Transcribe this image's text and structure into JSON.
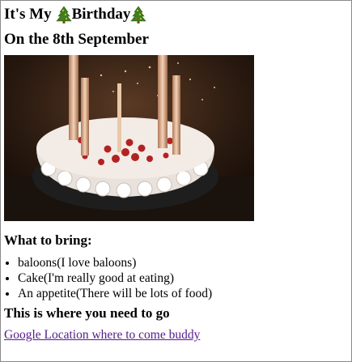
{
  "header": {
    "title_part1": "It's My",
    "title_part2": "Birthday",
    "left_icon": "christmas-tree-icon",
    "right_icon": "christmas-tree-icon",
    "date": "On the 8th September"
  },
  "photo": {
    "subject": "birthday-cake-with-candles"
  },
  "bring": {
    "heading": "What to bring:",
    "items": [
      "baloons(I love baloons)",
      "Cake(I'm really good at eating)",
      "An appetite(There will be lots of food)"
    ]
  },
  "location": {
    "heading": "This is where you need to go",
    "link_text": "Google Location where to come buddy"
  },
  "colors": {
    "link_visited": "#551a8b",
    "tree_green": "#3f7f1f"
  }
}
